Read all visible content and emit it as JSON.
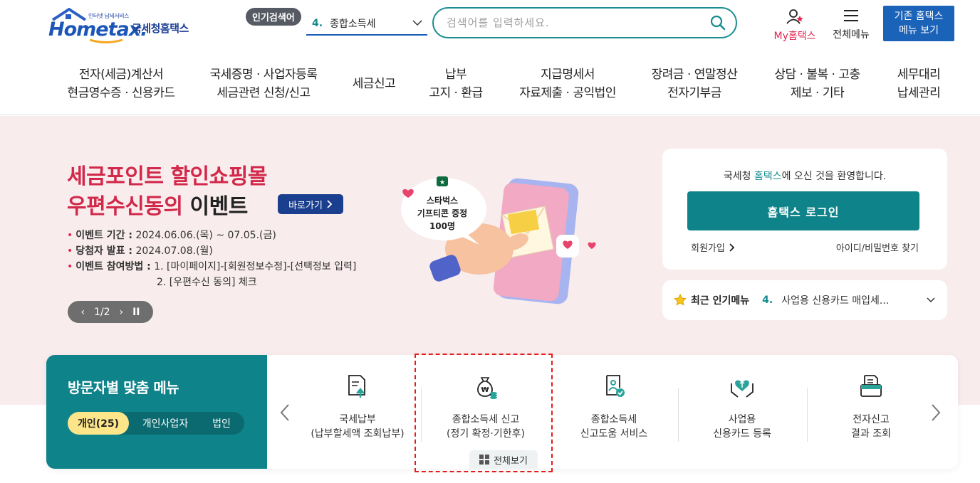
{
  "header": {
    "logo_sub": "인터넷 납세서비스",
    "logo_brand": "Hometax.",
    "logo_kor": "국세청홈택스",
    "popular_badge": "인기검색어",
    "popular_rank": "4.",
    "popular_term": "종합소득세",
    "search_placeholder": "검색어를 입력하세요.",
    "my_hometax": "My홈택스",
    "all_menu": "전체메뉴",
    "old_menu_line1": "기존 홈택스",
    "old_menu_line2": "메뉴 보기"
  },
  "nav": [
    {
      "line1": "전자(세금)계산서",
      "line2": "현금영수증 · 신용카드"
    },
    {
      "line1": "국세증명 · 사업자등록",
      "line2": "세금관련 신청/신고"
    },
    {
      "line1": "세금신고",
      "line2": ""
    },
    {
      "line1": "납부",
      "line2": "고지 · 환급"
    },
    {
      "line1": "지급명세서",
      "line2": "자료제출 · 공익법인"
    },
    {
      "line1": "장려금 · 연말정산",
      "line2": "전자기부금"
    },
    {
      "line1": "상담 · 불복 · 고충",
      "line2": "제보 · 기타"
    },
    {
      "line1": "세무대리",
      "line2": "납세관리"
    }
  ],
  "event": {
    "title_line1": "세금포인트 할인쇼핑몰",
    "title_line2_red": "우편수신동의",
    "title_line2_dark": " 이벤트",
    "goto_label": "바로가기",
    "period_label": "이벤트 기간 :",
    "period_value": " 2024.06.06.(목) ~ 07.05.(금)",
    "announce_label": "당첨자 발표 :",
    "announce_value": " 2024.07.08.(월)",
    "method_label": "이벤트 참여방법 :",
    "method_value1": " 1. [마이페이지]-[회원정보수정]-[선택정보 입력]",
    "method_value2": "2. [우편수신 동의] 체크",
    "pager": "1/2",
    "bubble_line1": "스타벅스",
    "bubble_line2": "기프티콘 증정",
    "bubble_line3": "100명"
  },
  "login": {
    "welcome_prefix": "국세청 ",
    "welcome_teal": "홈택스",
    "welcome_suffix": "에 오신 것을 환영합니다.",
    "login_button": "홈택스 로그인",
    "join": "회원가입",
    "find": "아이디/비밀번호 찾기"
  },
  "recent": {
    "title": "최근 인기메뉴",
    "rank": "4.",
    "value": "사업용 신용카드 매입세..."
  },
  "visitor": {
    "title": "방문자별 맞춤 메뉴",
    "segments": [
      "개인(25)",
      "개인사업자",
      "법인"
    ],
    "items": [
      {
        "icon": "document-upload-icon",
        "line1": "국세납부",
        "line2": "(납부할세액 조회납부)"
      },
      {
        "icon": "money-bag-icon",
        "line1": "종합소득세 신고",
        "line2": "(정기 확정·기한후)"
      },
      {
        "icon": "consult-document-icon",
        "line1": "종합소득세",
        "line2": "신고도움 서비스"
      },
      {
        "icon": "heart-hands-icon",
        "line1": "사업용",
        "line2": "신용카드 등록"
      },
      {
        "icon": "printer-result-icon",
        "line1": "전자신고",
        "line2": "결과 조회"
      }
    ],
    "view_all": "전체보기"
  },
  "colors": {
    "teal": "#0f838a",
    "brand_blue": "#1b63b8",
    "event_red": "#d2284a",
    "hero_bg": "#f8eced",
    "highlight_dashed": "#e51c1c",
    "segment_active": "#fde58a"
  }
}
